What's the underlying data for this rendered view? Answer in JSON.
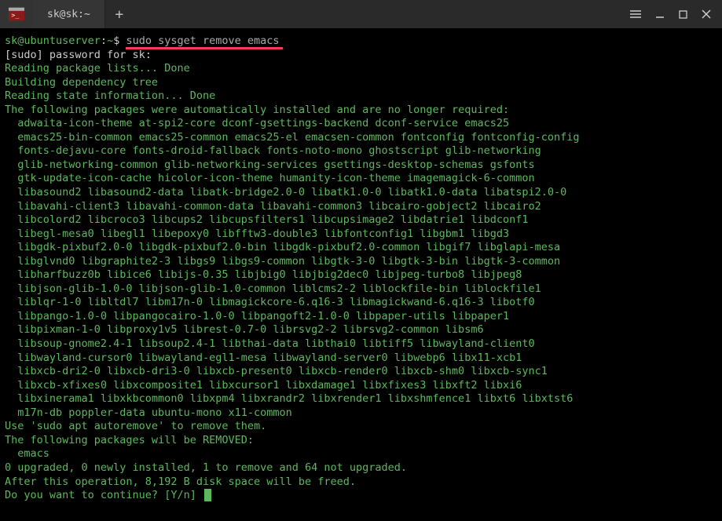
{
  "titlebar": {
    "tab_title": "sk@sk:~",
    "new_tab": "+",
    "menu_icon": "☰"
  },
  "prompt": {
    "user_host": "sk@ubuntuserver",
    "sep": ":",
    "path": "~",
    "dollar": "$",
    "command": "sudo sysget remove emacs"
  },
  "lines": {
    "sudo_prompt": "[sudo] password for sk:",
    "reading_pkg": "Reading package lists... Done",
    "building_tree": "Building dependency tree",
    "reading_state": "Reading state information... Done",
    "auto_installed": "The following packages were automatically installed and are no longer required:",
    "p01": "adwaita-icon-theme at-spi2-core dconf-gsettings-backend dconf-service emacs25",
    "p02": "emacs25-bin-common emacs25-common emacs25-el emacsen-common fontconfig fontconfig-config",
    "p03": "fonts-dejavu-core fonts-droid-fallback fonts-noto-mono ghostscript glib-networking",
    "p04": "glib-networking-common glib-networking-services gsettings-desktop-schemas gsfonts",
    "p05": "gtk-update-icon-cache hicolor-icon-theme humanity-icon-theme imagemagick-6-common",
    "p06": "libasound2 libasound2-data libatk-bridge2.0-0 libatk1.0-0 libatk1.0-data libatspi2.0-0",
    "p07": "libavahi-client3 libavahi-common-data libavahi-common3 libcairo-gobject2 libcairo2",
    "p08": "libcolord2 libcroco3 libcups2 libcupsfilters1 libcupsimage2 libdatrie1 libdconf1",
    "p09": "libegl-mesa0 libegl1 libepoxy0 libfftw3-double3 libfontconfig1 libgbm1 libgd3",
    "p10": "libgdk-pixbuf2.0-0 libgdk-pixbuf2.0-bin libgdk-pixbuf2.0-common libgif7 libglapi-mesa",
    "p11": "libglvnd0 libgraphite2-3 libgs9 libgs9-common libgtk-3-0 libgtk-3-bin libgtk-3-common",
    "p12": "libharfbuzz0b libice6 libijs-0.35 libjbig0 libjbig2dec0 libjpeg-turbo8 libjpeg8",
    "p13": "libjson-glib-1.0-0 libjson-glib-1.0-common liblcms2-2 liblockfile-bin liblockfile1",
    "p14": "liblqr-1-0 libltdl7 libm17n-0 libmagickcore-6.q16-3 libmagickwand-6.q16-3 libotf0",
    "p15": "libpango-1.0-0 libpangocairo-1.0-0 libpangoft2-1.0-0 libpaper-utils libpaper1",
    "p16": "libpixman-1-0 libproxy1v5 librest-0.7-0 librsvg2-2 librsvg2-common libsm6",
    "p17": "libsoup-gnome2.4-1 libsoup2.4-1 libthai-data libthai0 libtiff5 libwayland-client0",
    "p18": "libwayland-cursor0 libwayland-egl1-mesa libwayland-server0 libwebp6 libx11-xcb1",
    "p19": "libxcb-dri2-0 libxcb-dri3-0 libxcb-present0 libxcb-render0 libxcb-shm0 libxcb-sync1",
    "p20": "libxcb-xfixes0 libxcomposite1 libxcursor1 libxdamage1 libxfixes3 libxft2 libxi6",
    "p21": "libxinerama1 libxkbcommon0 libxpm4 libxrandr2 libxrender1 libxshmfence1 libxt6 libxtst6",
    "p22": "m17n-db poppler-data ubuntu-mono x11-common",
    "autoremove": "Use 'sudo apt autoremove' to remove them.",
    "will_remove": "The following packages will be REMOVED:",
    "emacs": "emacs",
    "summary": "0 upgraded, 0 newly installed, 1 to remove and 64 not upgraded.",
    "disk": "After this operation, 8,192 B disk space will be freed.",
    "continue": "Do you want to continue? [Y/n] "
  }
}
